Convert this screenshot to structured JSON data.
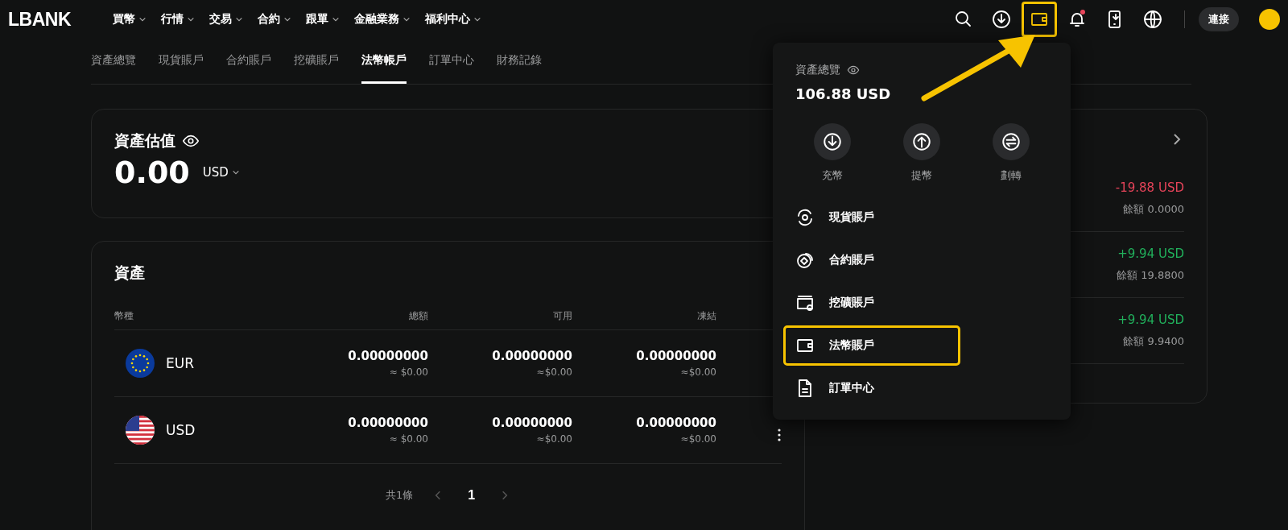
{
  "logo": "LBANK",
  "nav": [
    {
      "label": "買幣"
    },
    {
      "label": "行情"
    },
    {
      "label": "交易"
    },
    {
      "label": "合約"
    },
    {
      "label": "跟單"
    },
    {
      "label": "金融業務"
    },
    {
      "label": "福利中心"
    }
  ],
  "header_icons": [
    {
      "kind": "search",
      "highlighted": false,
      "dot": false
    },
    {
      "kind": "download",
      "highlighted": false,
      "dot": false
    },
    {
      "kind": "wallet",
      "highlighted": true,
      "dot": false
    },
    {
      "kind": "bell",
      "highlighted": false,
      "dot": true
    },
    {
      "kind": "phone",
      "highlighted": false,
      "dot": false
    },
    {
      "kind": "globe",
      "highlighted": false,
      "dot": false
    }
  ],
  "connect_button": "連接",
  "subtabs": [
    {
      "label": "資產總覽",
      "selected": false
    },
    {
      "label": "現貨賬戶",
      "selected": false
    },
    {
      "label": "合約賬戶",
      "selected": false
    },
    {
      "label": "挖礦賬戶",
      "selected": false
    },
    {
      "label": "法幣帳戶",
      "selected": true
    },
    {
      "label": "訂單中心",
      "selected": false
    },
    {
      "label": "財務記錄",
      "selected": false
    }
  ],
  "estimate": {
    "title": "資產估值",
    "value": "0.00",
    "currency": "USD"
  },
  "assets": {
    "title": "資產",
    "columns": [
      "幣種",
      "總額",
      "可用",
      "凍結"
    ],
    "rows": [
      {
        "kind": "eu",
        "currency": "EUR",
        "total": "0.00000000",
        "total_usd": "≈ $0.00",
        "available": "0.00000000",
        "available_usd": "≈$0.00",
        "frozen": "0.00000000",
        "frozen_usd": "≈$0.00"
      },
      {
        "kind": "us",
        "currency": "USD",
        "total": "0.00000000",
        "total_usd": "≈ $0.00",
        "available": "0.00000000",
        "available_usd": "≈$0.00",
        "frozen": "0.00000000",
        "frozen_usd": "≈$0.00",
        "more_icon": true
      }
    ],
    "pagination": {
      "total": "共1條",
      "page": "1"
    }
  },
  "side_card": {
    "items": [
      {
        "change": "-19.88 USD",
        "kind": "down",
        "balance": "餘額 0.0000"
      },
      {
        "change": "+9.94 USD",
        "kind": "up",
        "balance": "餘額 19.8800"
      },
      {
        "change": "+9.94 USD",
        "kind": "up",
        "balance": "餘額 9.9400"
      }
    ]
  },
  "wallet_menu": {
    "title": "資產總覽",
    "amount": "106.88 USD",
    "actions": [
      {
        "kind": "deposit",
        "label": "充幣"
      },
      {
        "kind": "withdraw",
        "label": "提幣"
      },
      {
        "kind": "transfer",
        "label": "劃轉"
      }
    ],
    "items": [
      {
        "kind": "spot",
        "label": "現貨賬戶",
        "highlighted": false
      },
      {
        "kind": "futures",
        "label": "合約賬戶",
        "highlighted": false
      },
      {
        "kind": "mining",
        "label": "挖礦賬戶",
        "highlighted": false
      },
      {
        "kind": "fiat",
        "label": "法幣賬戶",
        "highlighted": true
      },
      {
        "kind": "orders",
        "label": "訂單中心",
        "highlighted": false
      }
    ]
  }
}
